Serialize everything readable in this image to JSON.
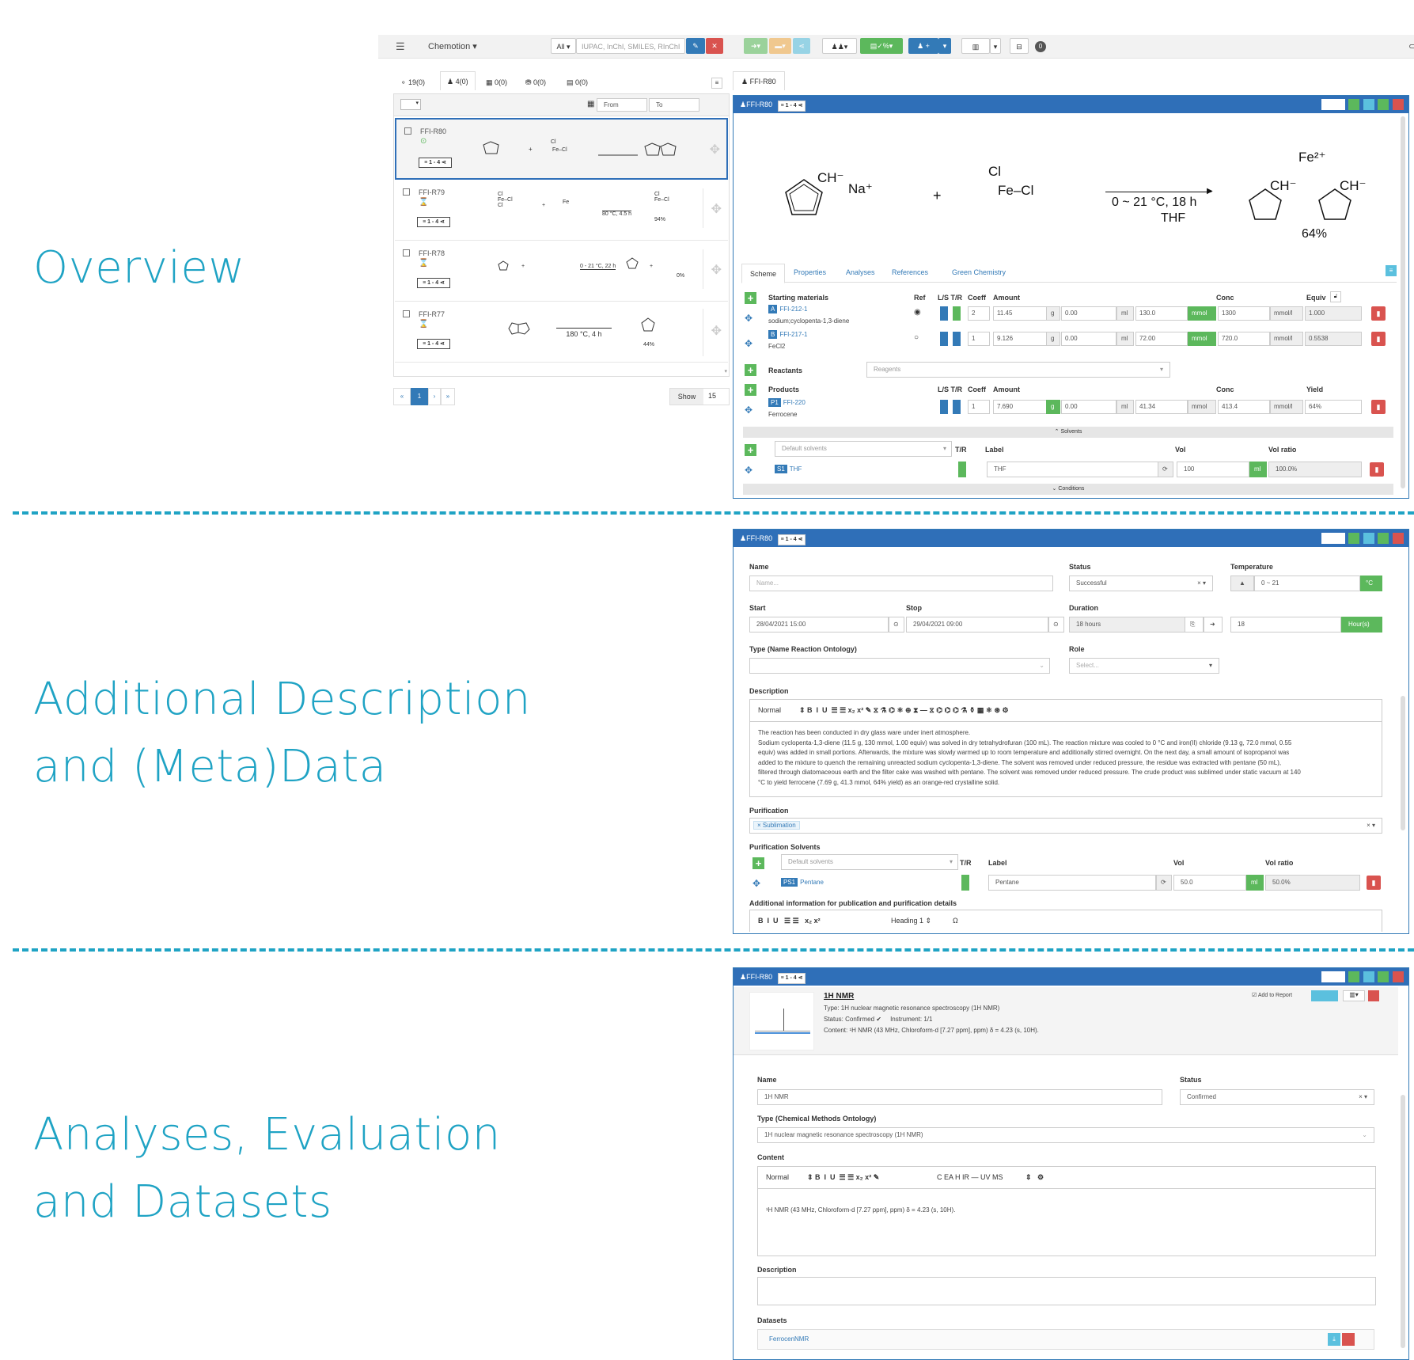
{
  "sections": {
    "overview": "Overview",
    "additional_line1": "Additional Description",
    "additional_line2": "and (Meta)Data",
    "analyses_line1": "Analyses, Evaluation",
    "analyses_line2": "and Datasets"
  },
  "topbar": {
    "collection": "Chemotion",
    "search_scope": "All",
    "search_placeholder": "IUPAC, InChI, SMILES, RInChI"
  },
  "element_tabs": [
    "19(0)",
    "4(0)",
    "0(0)",
    "0(0)",
    "0(0)"
  ],
  "list": {
    "date_from": "From",
    "date_to": "To",
    "rows": [
      {
        "name": "FFI-R80",
        "tag": "1 - 4",
        "scheme": "",
        "yield": ""
      },
      {
        "name": "FFI-R79",
        "tag": "1 - 4",
        "scheme": "80 °C, 4.5 h",
        "yield": "94%"
      },
      {
        "name": "FFI-R78",
        "tag": "1 - 4",
        "scheme": "0 - 21 °C, 22 h",
        "yield": "0%"
      },
      {
        "name": "FFI-R77",
        "tag": "1 - 4",
        "scheme": "180 °C, 4 h",
        "yield": "44%"
      }
    ],
    "page": "1",
    "show_label": "Show",
    "show_value": "15"
  },
  "detail_tab": "FFI-R80",
  "panel_overview": {
    "title": "FFI-R80",
    "tag": "1 - 4",
    "scheme": {
      "reactant1": "CH⁻",
      "reactant1_ion": "Na⁺",
      "plus": "+",
      "reactant2_top": "Cl",
      "reactant2": "Fe–Cl",
      "conditions": "0 ~ 21 °C, 18 h",
      "solvent": "THF",
      "product_ion": "Fe²⁺",
      "product_a": "CH⁻",
      "product_b": "CH⁻",
      "yield": "64%"
    },
    "tabs": [
      "Scheme",
      "Properties",
      "Analyses",
      "References",
      "Green Chemistry"
    ],
    "headers": {
      "starting": "Starting materials",
      "ref": "Ref",
      "lstr": "L/S T/R",
      "coeff": "Coeff",
      "amount": "Amount",
      "conc": "Conc",
      "equiv": "Equiv",
      "reactants": "Reactants",
      "reagents": "Reagents",
      "products": "Products",
      "yield": "Yield",
      "solvents_toggle": "Solvents",
      "default_solvents": "Default solvents",
      "tr": "T/R",
      "label": "Label",
      "vol": "Vol",
      "vol_ratio": "Vol ratio",
      "conditions_toggle": "Conditions"
    },
    "starting_materials": [
      {
        "badge": "A",
        "id": "FFI-212-1",
        "name": "sodium;cyclopenta-1,3-diene",
        "coeff": "2",
        "g": "11.45",
        "ml": "0.00",
        "mmol": "130.0",
        "conc": "1300",
        "equiv": "1.000"
      },
      {
        "badge": "B",
        "id": "FFI-217-1",
        "name": "FeCl2",
        "coeff": "1",
        "g": "9.126",
        "ml": "0.00",
        "mmol": "72.00",
        "conc": "720.0",
        "equiv": "0.5538"
      }
    ],
    "products": [
      {
        "badge": "P1",
        "id": "FFI-220",
        "name": "Ferrocene",
        "coeff": "1",
        "g": "7.690",
        "ml": "0.00",
        "mmol": "41.34",
        "conc": "413.4",
        "yield": "64%"
      }
    ],
    "units": {
      "g": "g",
      "ml": "ml",
      "mmol": "mmol",
      "mmoll": "mmol/l"
    },
    "solvent": {
      "badge": "S1",
      "name": "THF",
      "label": "THF",
      "vol": "100",
      "unit": "ml",
      "ratio": "100.0%"
    }
  },
  "panel_meta": {
    "title": "FFI-R80",
    "tag": "1 - 4",
    "labels": {
      "name": "Name",
      "status": "Status",
      "temperature": "Temperature",
      "start": "Start",
      "stop": "Stop",
      "duration": "Duration",
      "type": "Type (Name Reaction Ontology)",
      "role": "Role",
      "description": "Description",
      "purification": "Purification",
      "purification_solvents": "Purification Solvents",
      "additional": "Additional information for publication and purification details",
      "tr": "T/R",
      "label": "Label",
      "vol": "Vol",
      "vol_ratio": "Vol ratio"
    },
    "name_placeholder": "Name...",
    "status": "Successful",
    "temperature": "0 ~ 21",
    "temp_unit": "°C",
    "start": "28/04/2021 15:00",
    "stop": "29/04/2021 09:00",
    "duration": "18 hours",
    "duration_value": "18",
    "duration_unit": "Hour(s)",
    "role_placeholder": "Select...",
    "editor_style": "Normal",
    "editor_heading": "Heading 1",
    "description_text": [
      "The reaction has been conducted in dry glass ware under inert atmosphere.",
      "Sodium cyclopenta-1,3-diene (11.5 g, 130 mmol, 1.00 equiv) was solved in dry tetrahydrofuran (100 mL). The reaction mixture was cooled to 0 °C and iron(II) chloride (9.13 g, 72.0 mmol, 0.55",
      "equiv) was added in small portions. Afterwards, the mixture was slowly warmed up to room temperature and additionally stirred overnight. On the next day, a small amount of isopropanol was",
      "added to the mixture to quench the remaining unreacted sodium cyclopenta-1,3-diene. The solvent was removed under reduced pressure, the residue was extracted with pentane (50 mL),",
      "filtered through diatomaceous earth and the filter cake was washed with pentane. The solvent was removed under reduced pressure. The crude product was sublimed under static vacuum at 140",
      "°C to yield ferrocene (7.69 g, 41.3 mmol, 64% yield) as an orange-red crystalline solid."
    ],
    "purification_tag": "Sublimation",
    "default_solvents": "Default solvents",
    "solvent": {
      "badge": "PS1",
      "name": "Pentane",
      "label": "Pentane",
      "vol": "50.0",
      "unit": "ml",
      "ratio": "50.0%"
    }
  },
  "panel_analyses": {
    "title": "FFI-R80",
    "tag": "1 - 4",
    "summary": {
      "title": "1H NMR",
      "type": "Type: 1H nuclear magnetic resonance spectroscopy (1H NMR)",
      "status": "Status: Confirmed",
      "instrument": "Instrument: 1/1",
      "content": "Content: ¹H NMR (43 MHz, Chloroform-d [7.27 ppm], ppm) δ = 4.23 (s, 10H)."
    },
    "add_to_report": "Add to Report",
    "labels": {
      "name": "Name",
      "status": "Status",
      "type": "Type (Chemical Methods Ontology)",
      "content": "Content",
      "description": "Description",
      "datasets": "Datasets"
    },
    "name": "1H NMR",
    "status": "Confirmed",
    "type": "1H nuclear magnetic resonance spectroscopy (1H NMR)",
    "editor_style": "Normal",
    "editor_extra": "C  EA  H  IR  —  UV  MS",
    "content_text": "¹H NMR (43 MHz, Chloroform-d [7.27 ppm], ppm) δ = 4.23 (s, 10H).",
    "dataset": "FerrocenNMR"
  }
}
